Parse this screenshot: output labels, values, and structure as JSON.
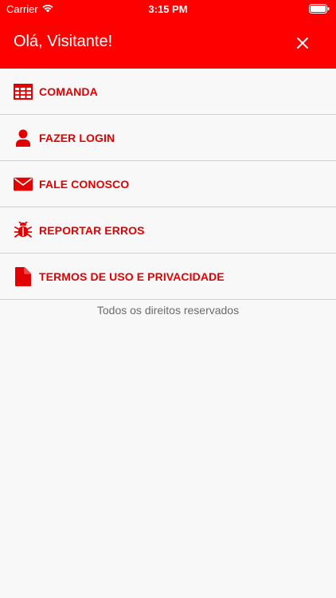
{
  "status_bar": {
    "carrier": "Carrier",
    "time": "3:15 PM"
  },
  "header": {
    "title": "Olá, Visitante!",
    "close_icon": "close-icon"
  },
  "menu": {
    "items": [
      {
        "label": "COMANDA",
        "icon": "table-icon"
      },
      {
        "label": "FAZER LOGIN",
        "icon": "user-icon"
      },
      {
        "label": "FALE CONOSCO",
        "icon": "envelope-icon"
      },
      {
        "label": "REPORTAR ERROS",
        "icon": "bug-icon"
      },
      {
        "label": "TERMOS DE USO E PRIVACIDADE",
        "icon": "document-icon"
      }
    ]
  },
  "footer": {
    "text": "Todos os direitos reservados"
  },
  "colors": {
    "accent": "#fe0000",
    "label": "#e30000",
    "background": "#f8f8f8",
    "divider": "#cfcfcf",
    "footer_text": "#6b6b6b"
  }
}
